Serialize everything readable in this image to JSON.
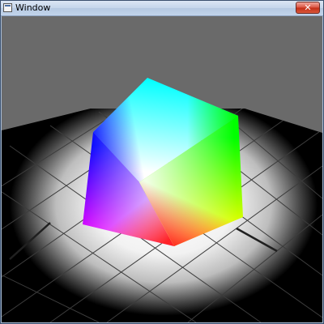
{
  "window": {
    "title": "Window",
    "close_label": "✕"
  },
  "scene": {
    "background_color": "#6a6a6a",
    "floor_color": "#000000",
    "spotlight_color": "#ffffff",
    "grid_line_color": "#3c3c3c",
    "cube": {
      "faces": [
        "top",
        "left",
        "right"
      ],
      "vertex_colors": {
        "top_back": "#00ffff",
        "left_top": "#0000ff",
        "right_top": "#00ff00",
        "front_corner": "#ffffff",
        "left_bottom": "#ff00ff",
        "right_bottom": "#ffff00",
        "bottom_front": "#ff0000"
      }
    }
  }
}
